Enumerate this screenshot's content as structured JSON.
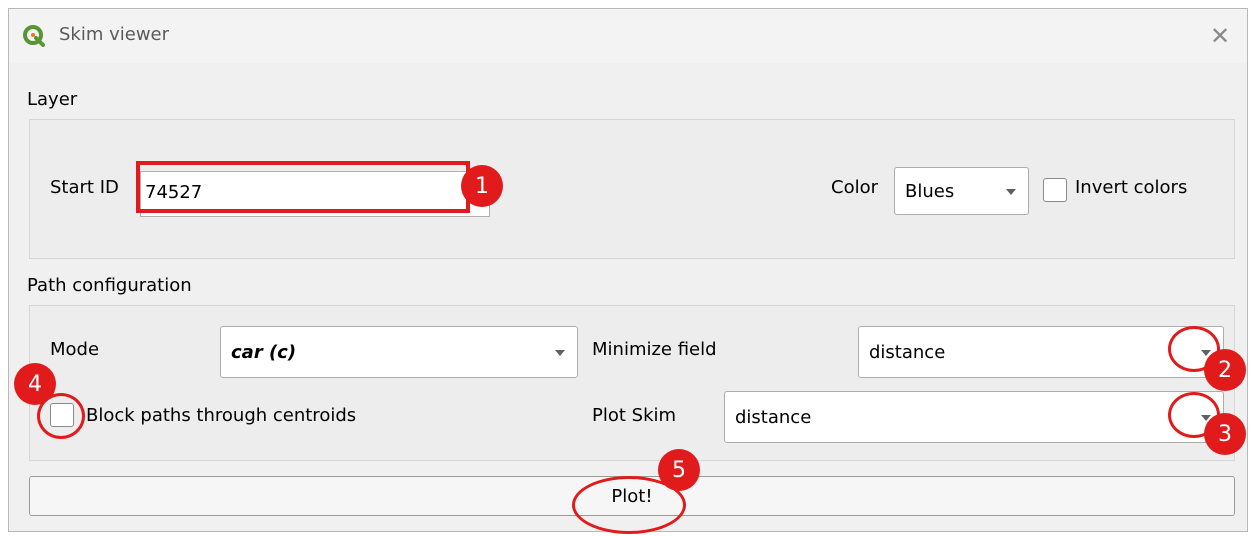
{
  "window": {
    "title": "Skim viewer",
    "close_glyph": "✕"
  },
  "layer_section": {
    "label": "Layer",
    "start_id_label": "Start ID",
    "start_id_value": "74527",
    "color_label": "Color",
    "color_value": "Blues",
    "invert_label": "Invert colors",
    "invert_checked": false
  },
  "path_section": {
    "label": "Path configuration",
    "mode_label": "Mode",
    "mode_value": "car (c)",
    "minimize_label": "Minimize field",
    "minimize_value": "distance",
    "block_label": "Block paths through centroids",
    "block_checked": false,
    "plot_skim_label": "Plot Skim",
    "plot_skim_value": "distance"
  },
  "plot_button": {
    "label": "Plot!"
  },
  "annotations": {
    "badge_1": "1",
    "badge_2": "2",
    "badge_3": "3",
    "badge_4": "4",
    "badge_5": "5",
    "highlight_color": "#e11b1b"
  },
  "icons": {
    "app": "qgis-logo-icon",
    "close": "close-icon",
    "dropdown": "chevron-down-icon"
  }
}
